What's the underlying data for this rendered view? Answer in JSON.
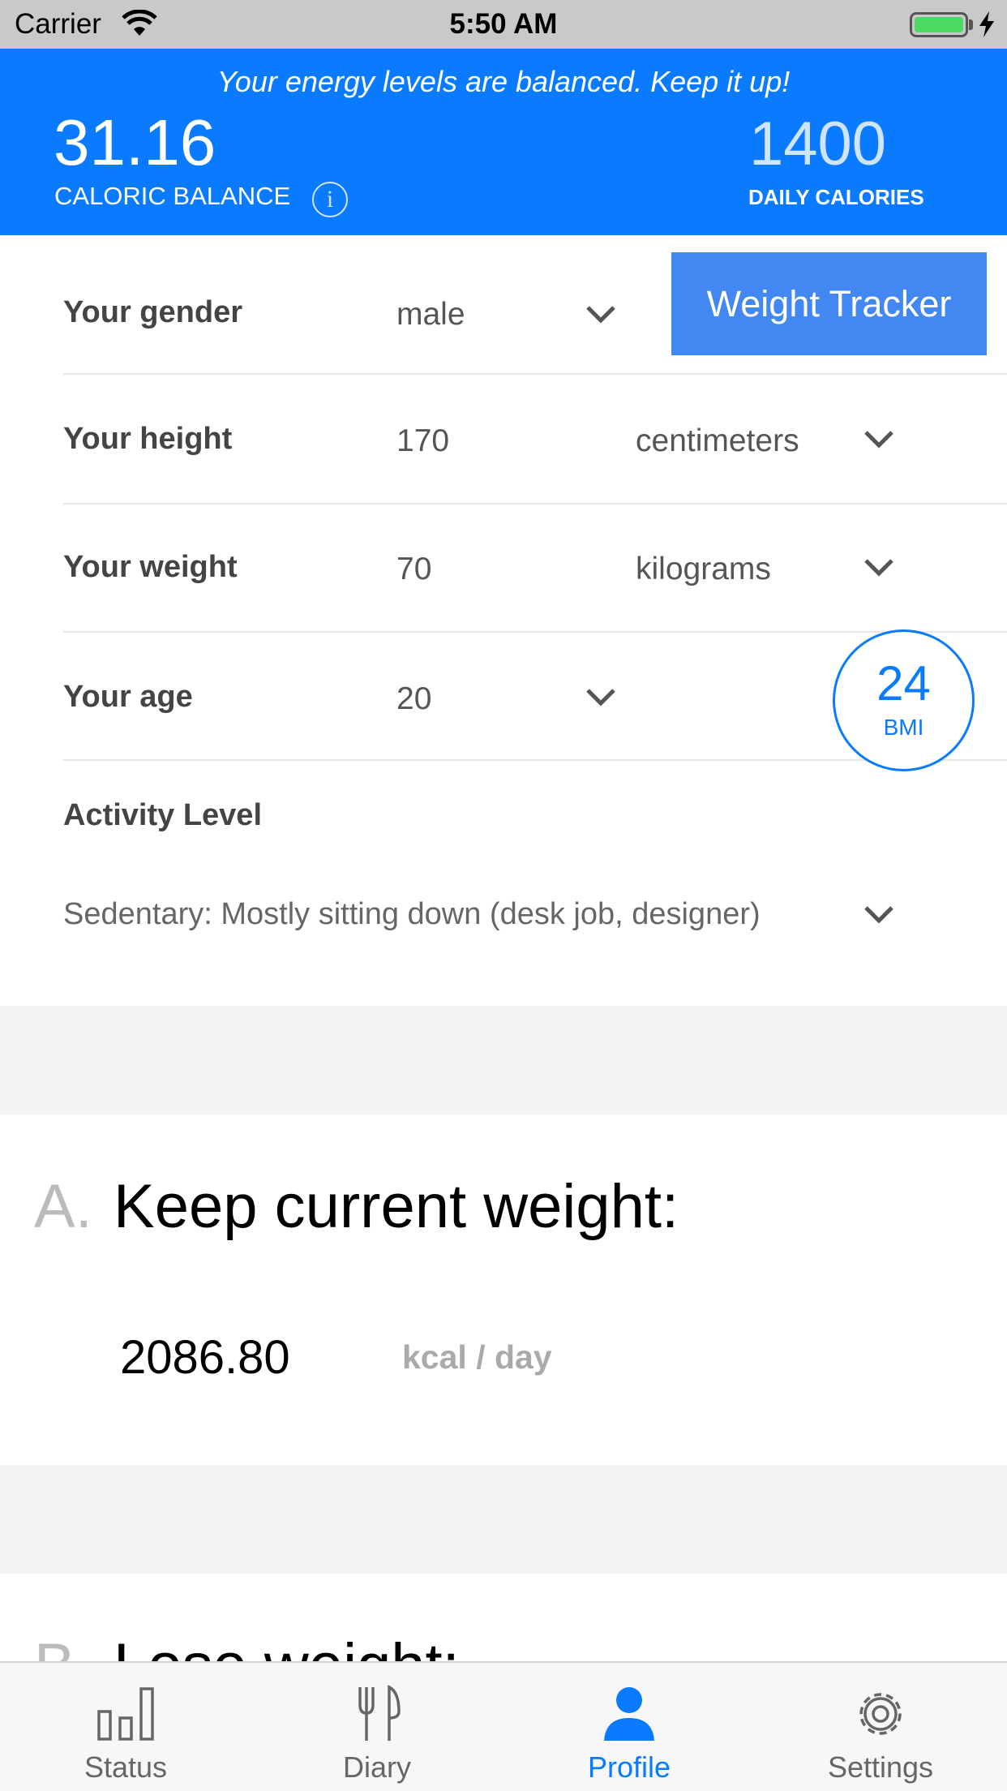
{
  "status_bar": {
    "carrier": "Carrier",
    "time": "5:50 AM"
  },
  "header": {
    "message": "Your energy levels are balanced. Keep it up!",
    "caloric_balance": "31.16",
    "caloric_balance_label": "CALORIC BALANCE",
    "daily_calories": "1400",
    "daily_calories_label": "DAILY CALORIES"
  },
  "profile": {
    "gender": {
      "label": "Your gender",
      "value": "male"
    },
    "height": {
      "label": "Your height",
      "value": "170",
      "unit": "centimeters"
    },
    "weight": {
      "label": "Your weight",
      "value": "70",
      "unit": "kilograms"
    },
    "age": {
      "label": "Your age",
      "value": "20"
    },
    "weight_tracker_button": "Weight Tracker",
    "bmi": {
      "value": "24",
      "label": "BMI"
    },
    "activity": {
      "title": "Activity Level",
      "value": "Sedentary: Mostly sitting down (desk job, designer)"
    }
  },
  "goals": [
    {
      "letter": "A.",
      "title": "Keep current weight:",
      "value": "2086.80",
      "unit": "kcal / day"
    },
    {
      "letter": "B.",
      "title": "Lose weight:"
    }
  ],
  "tabs": [
    {
      "label": "Status",
      "icon": "bar-chart-icon",
      "active": false
    },
    {
      "label": "Diary",
      "icon": "fork-knife-icon",
      "active": false
    },
    {
      "label": "Profile",
      "icon": "person-icon",
      "active": true
    },
    {
      "label": "Settings",
      "icon": "gear-icon",
      "active": false
    }
  ],
  "colors": {
    "accent": "#0a7aff",
    "button": "#4388f2",
    "gap": "#f2f3f5"
  }
}
